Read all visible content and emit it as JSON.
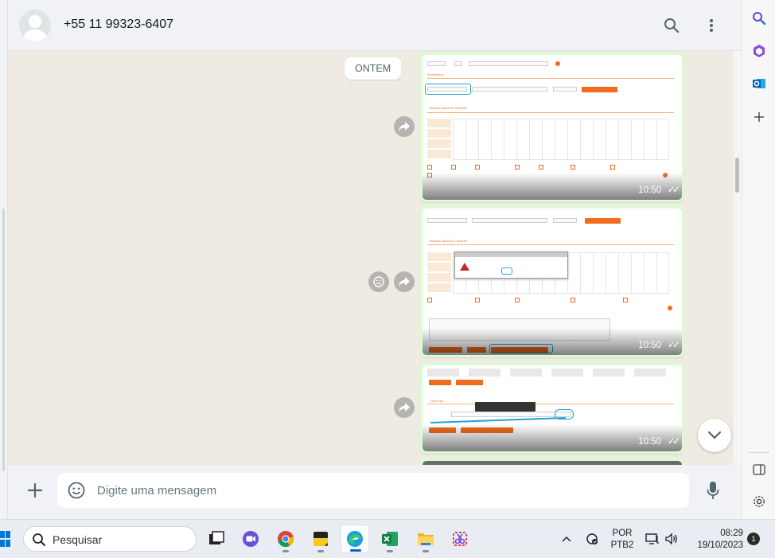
{
  "header": {
    "contact_name": "+55 11 99323-6407",
    "search_icon": "search-icon",
    "menu_icon": "more-vertical-icon"
  },
  "chat": {
    "date_label": "ONTEM",
    "messages": [
      {
        "time": "10:50",
        "status_icon": "double-check-icon"
      },
      {
        "time": "10:50",
        "status_icon": "double-check-icon"
      },
      {
        "time": "10:50",
        "status_icon": "double-check-icon"
      }
    ]
  },
  "composer": {
    "placeholder": "Digite uma mensagem",
    "value": ""
  },
  "taskbar": {
    "search_label": "Pesquisar",
    "lang_line1": "POR",
    "lang_line2": "PTB2",
    "time": "08:29",
    "date": "19/10/2023",
    "notifications": "1"
  },
  "colors": {
    "bubble": "#d9fdd3",
    "chat_bg": "#efeae2",
    "accent": "#f26c1f",
    "highlight": "#1ea6d8"
  }
}
